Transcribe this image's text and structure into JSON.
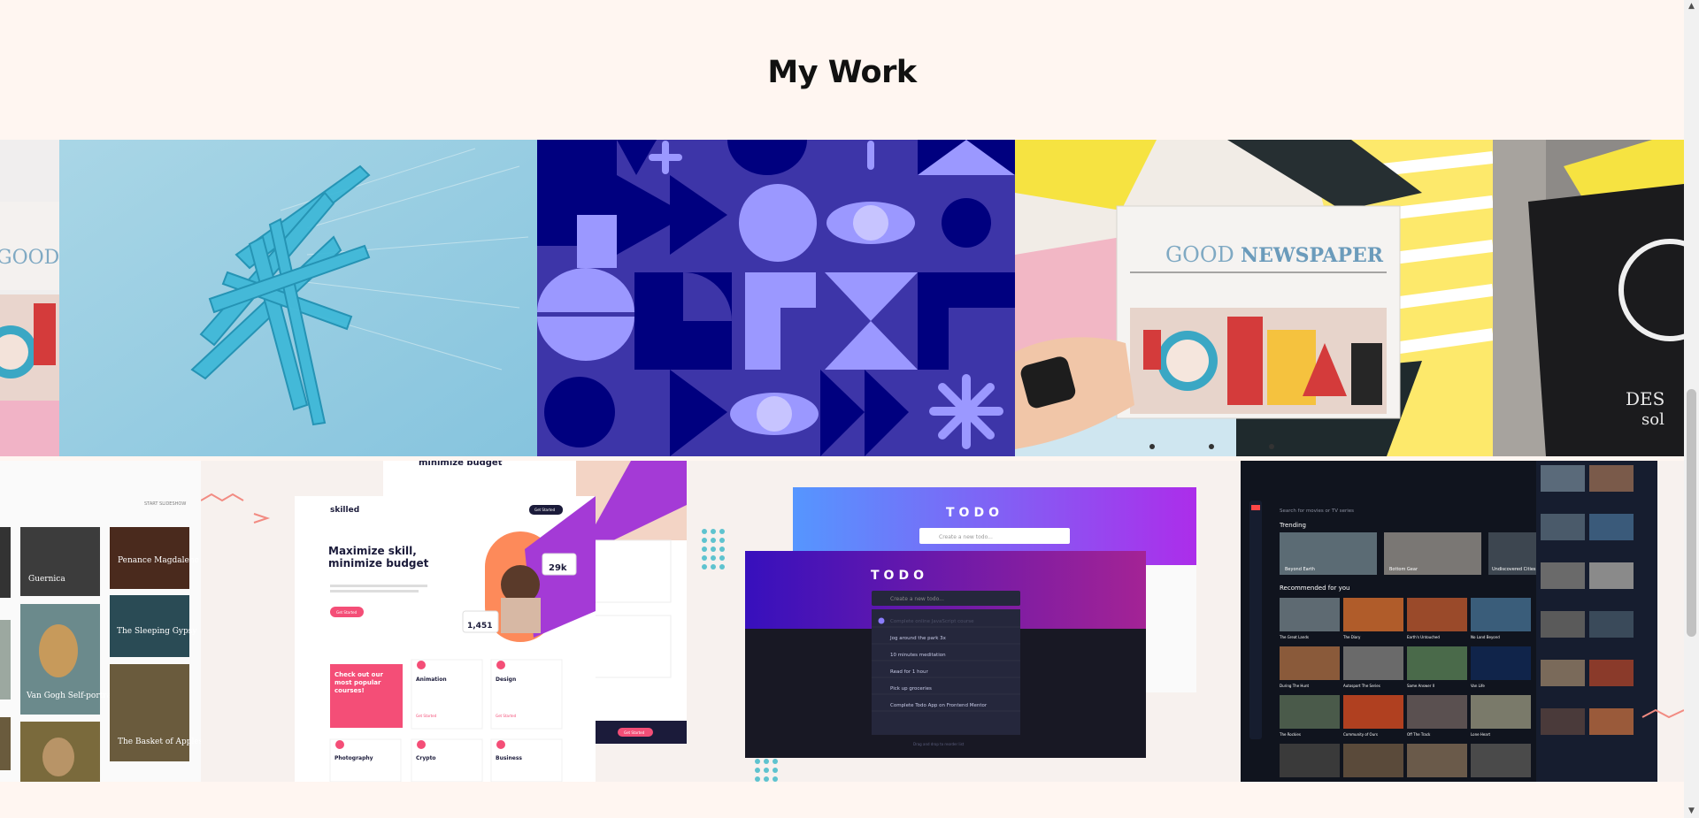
{
  "section": {
    "title": "My Work"
  },
  "gallery": {
    "newspaper_masthead_good": "GOOD",
    "newspaper_masthead_news": "NEWSPAPER",
    "partial_masthead": "GOOD",
    "book_cover_text": "DES",
    "book_cover_text2": "sol"
  },
  "projects": {
    "art_gallery": {
      "header": "START SLIDESHOW",
      "items": [
        "Guernica",
        "Penance Magdalene",
        "The Sleeping Gypsy",
        "Van Gogh Self-portrait",
        "The Basket of Apples"
      ]
    },
    "skilled": {
      "logo": "skilled",
      "cta_top": "Get Started",
      "hero": "Maximize skill, minimize budget",
      "hero_top_partial": "minimize budget",
      "hero_button": "Get Started",
      "stat_big": "29k",
      "stat_small": "1,451",
      "card_pink": "Check out our most popular courses!",
      "courses": [
        "Animation",
        "Design",
        "Photography",
        "Crypto",
        "Business"
      ],
      "link": "Get Started",
      "side_cta": "Get Started"
    },
    "todo": {
      "title_back": "TODO",
      "title_front": "TODO",
      "input_placeholder": "Create a new todo...",
      "items": [
        "Complete online JavaScript course",
        "Jog around the park 3x",
        "10 minutes meditation",
        "Read for 1 hour",
        "Pick up groceries",
        "Complete Todo App on Frontend Mentor"
      ],
      "footer": "Drag and drop to reorder list"
    },
    "movies": {
      "search_placeholder": "Search for movies or TV series",
      "trending_label": "Trending",
      "recommended_label": "Recommended for you",
      "trending_titles": [
        "Beyond Earth",
        "Bottom Gear",
        "Undiscovered Cities"
      ],
      "recommended_titles": [
        "The Great Lands",
        "The Diary",
        "Earth's Untouched",
        "No Land Beyond",
        "During The Hunt",
        "Autosport The Series",
        "Same Answer II",
        "Van Life",
        "The Rockies",
        "Community of Ours",
        "Off The Track",
        "Lone Heart"
      ]
    }
  },
  "colors": {
    "page_bg": "#fff6f1",
    "accent_pink": "#f44e77",
    "purple": "#3d35a8",
    "navy": "#00007f",
    "lavender": "#9b98ff"
  }
}
